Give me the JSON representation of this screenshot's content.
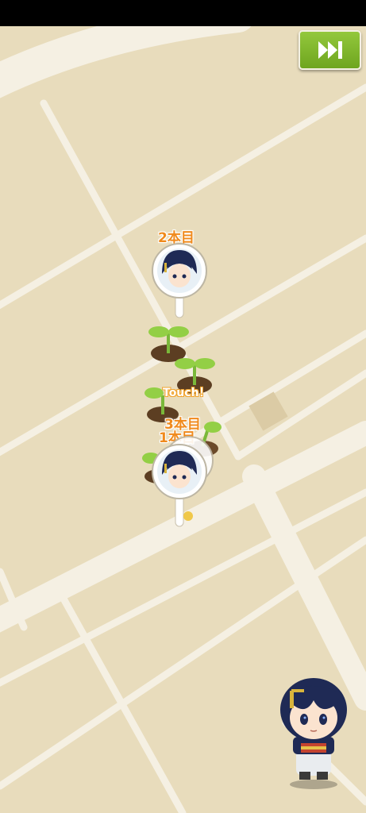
{
  "status_bar": {
    "color": "#000000"
  },
  "map": {
    "background_color": "#e8dcbc",
    "road_color": "#f5f0e3"
  },
  "skip_button": {
    "icon": "fast-forward-icon",
    "color": "#7cb32a"
  },
  "markers": [
    {
      "label": "2本目",
      "portrait": "character-portrait"
    },
    {
      "label": "3本目",
      "portrait": "character-portrait"
    },
    {
      "label": "1本目",
      "portrait": "character-portrait"
    }
  ],
  "sprouts": {
    "icon": "sprout-icon",
    "count": 5
  },
  "touch_hint": "Touch！",
  "companion": {
    "icon": "chibi-character-icon"
  }
}
